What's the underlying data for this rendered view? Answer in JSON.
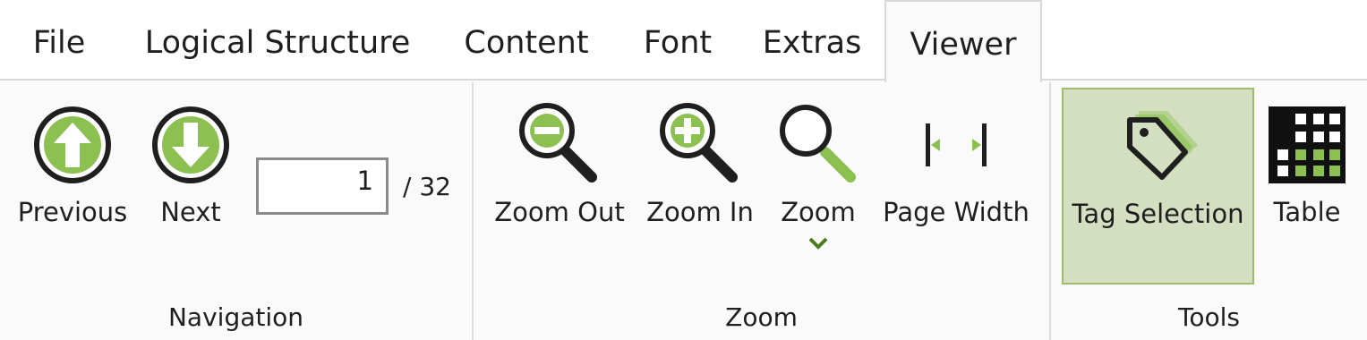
{
  "tabs": {
    "file": "File",
    "logical_structure": "Logical Structure",
    "content": "Content",
    "font": "Font",
    "extras": "Extras",
    "viewer": "Viewer",
    "active": "Viewer"
  },
  "navigation": {
    "previous_label": "Previous",
    "next_label": "Next",
    "page_value": "1",
    "page_total": "/ 32",
    "group_label": "Navigation"
  },
  "zoom": {
    "zoom_out_label": "Zoom Out",
    "zoom_in_label": "Zoom In",
    "zoom_label": "Zoom",
    "page_width_label": "Page Width",
    "group_label": "Zoom"
  },
  "tools": {
    "tag_selection_label": "Tag Selection",
    "table_label": "Table",
    "group_label": "Tools"
  },
  "colors": {
    "accent_green": "#8cc152",
    "selected_bg": "#d4dfc2",
    "selected_border": "#9fba6f",
    "icon_dark": "#1f1f1f"
  },
  "icons": [
    "arrow-up-circle-icon",
    "arrow-down-circle-icon",
    "zoom-out-icon",
    "zoom-in-icon",
    "zoom-icon",
    "page-width-icon",
    "tag-icon",
    "table-icon",
    "chevron-down-icon"
  ]
}
